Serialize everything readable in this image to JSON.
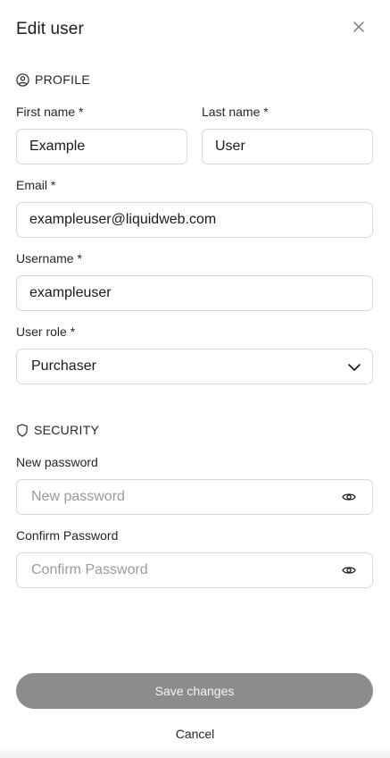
{
  "dialog": {
    "title": "Edit user",
    "close_icon": "close-icon"
  },
  "profile": {
    "heading": "PROFILE",
    "icon": "user-circle-icon",
    "first_name_label": "First name",
    "first_name_value": "Example",
    "last_name_label": "Last name",
    "last_name_value": "User",
    "email_label": "Email",
    "email_value": "exampleuser@liquidweb.com",
    "username_label": "Username",
    "username_value": "exampleuser",
    "role_label": "User role",
    "role_value": "Purchaser",
    "required_mark": "*"
  },
  "security": {
    "heading": "SECURITY",
    "icon": "shield-icon",
    "new_password_label": "New password",
    "new_password_placeholder": "New password",
    "confirm_password_label": "Confirm Password",
    "confirm_password_placeholder": "Confirm Password",
    "visibility_icon": "eye-icon"
  },
  "actions": {
    "save_label": "Save changes",
    "cancel_label": "Cancel"
  },
  "colors": {
    "save_button_bg": "#8c8c8c",
    "border": "#d9d9d9",
    "text": "#1f1f1f"
  }
}
